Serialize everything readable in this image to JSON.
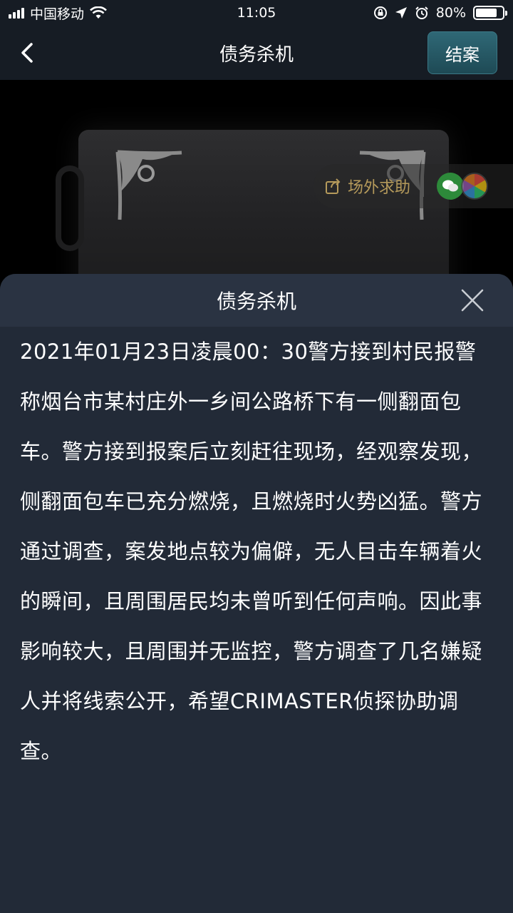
{
  "status_bar": {
    "carrier": "中国移动",
    "time": "11:05",
    "battery_percent": "80%",
    "battery_level": 0.8,
    "icons": [
      "signal-icon",
      "wifi-icon",
      "rotation-lock-icon",
      "location-icon",
      "alarm-icon",
      "battery-icon"
    ]
  },
  "nav": {
    "title": "债务杀机",
    "close_case_label": "结案",
    "accent_color": "#2a5d69"
  },
  "scene": {
    "help_label": "场外求助"
  },
  "sheet": {
    "title": "债务杀机",
    "body": "2021年01月23日凌晨00：30警方接到村民报警称烟台市某村庄外一乡间公路桥下有一侧翻面包车。警方接到报案后立刻赶往现场，经观察发现，侧翻面包车已充分燃烧，且燃烧时火势凶猛。警方通过调查，案发地点较为偏僻，无人目击车辆着火的瞬间，且周围居民均未曾听到任何声响。因此事影响较大，且周围并无监控，警方调查了几名嫌疑人并将线索公开，希望CRIMASTER侦探协助调查。"
  }
}
